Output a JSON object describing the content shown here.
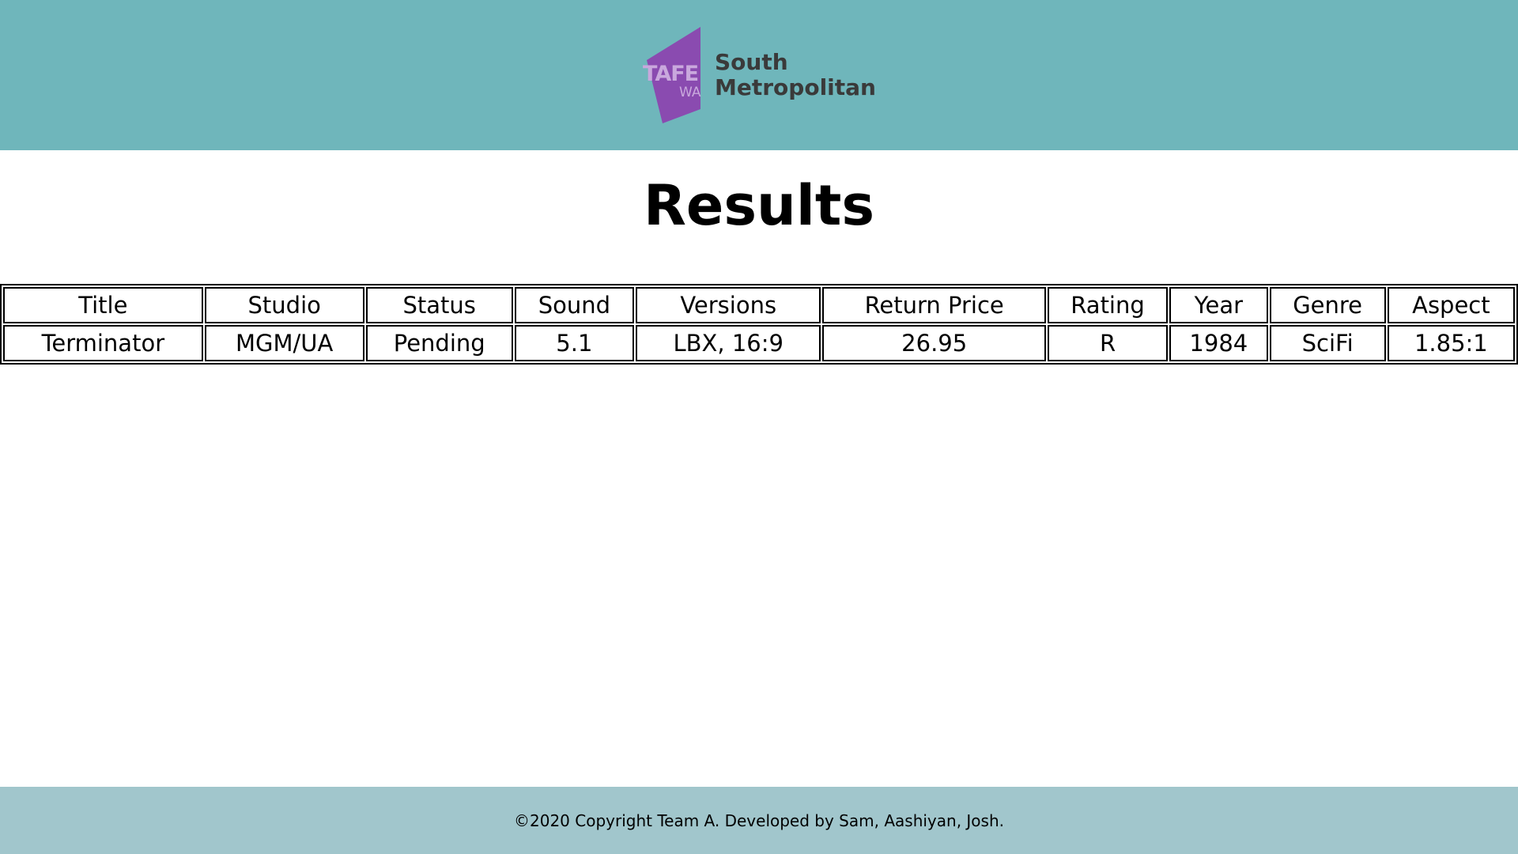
{
  "header": {
    "logo": {
      "mark_text_top": "TAFE",
      "mark_text_bottom": "WA",
      "line1": "South",
      "line2": "Metropolitan",
      "mark_color": "#8a4bb0",
      "text_color": "#3a3a3a"
    },
    "background": "#6fb6bb"
  },
  "main": {
    "title": "Results",
    "table": {
      "columns": [
        "Title",
        "Studio",
        "Status",
        "Sound",
        "Versions",
        "Return Price",
        "Rating",
        "Year",
        "Genre",
        "Aspect"
      ],
      "rows": [
        [
          "Terminator",
          "MGM/UA",
          "Pending",
          "5.1",
          "LBX, 16:9",
          "26.95",
          "R",
          "1984",
          "SciFi",
          "1.85:1"
        ]
      ]
    }
  },
  "footer": {
    "copyright": "©2020 Copyright Team A. Developed by Sam, Aashiyan, Josh.",
    "background": "#a1c6cc"
  }
}
